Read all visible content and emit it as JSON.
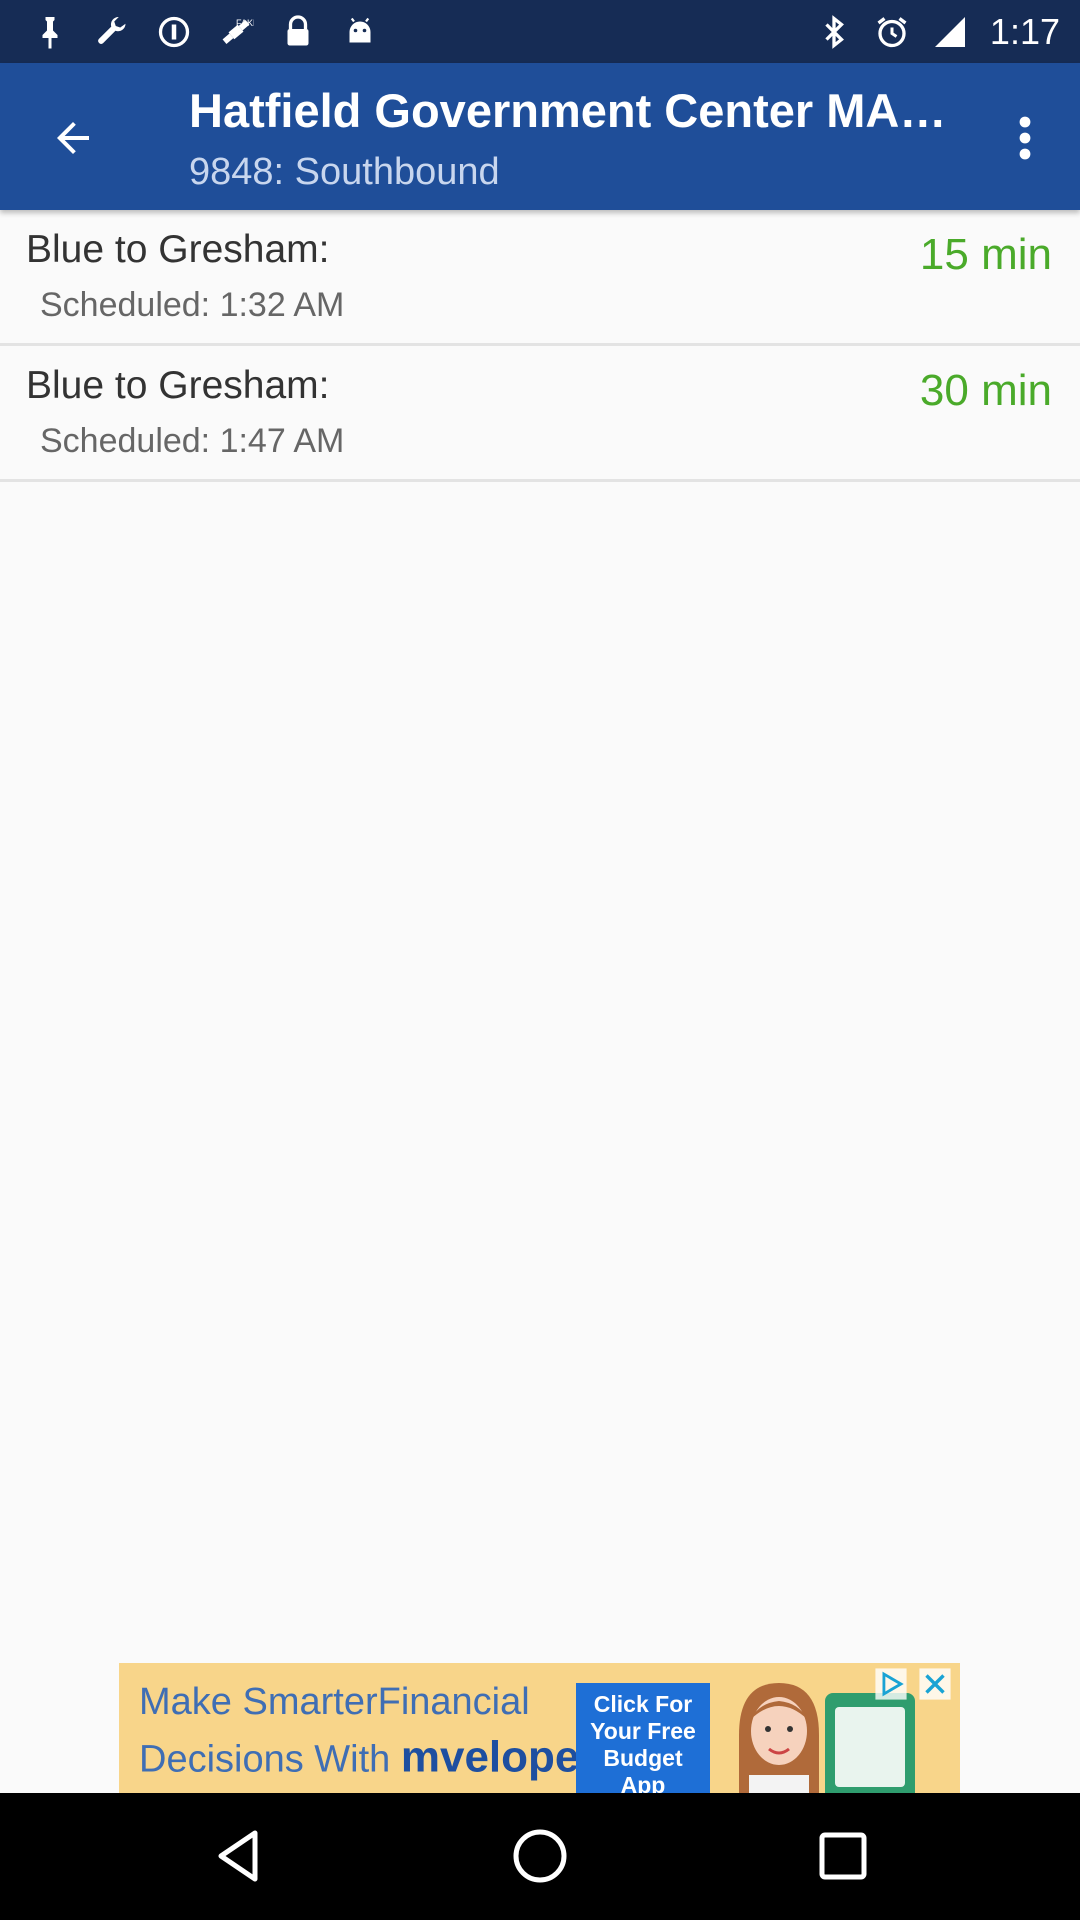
{
  "status_bar": {
    "time": "1:17",
    "left_icons": [
      "pin-icon",
      "wrench-icon",
      "data-saver-icon",
      "fake-gps-icon",
      "lock-icon",
      "android-icon"
    ],
    "right_icons": [
      "bluetooth-icon",
      "alarm-icon",
      "signal-icon"
    ]
  },
  "app_bar": {
    "title": "Hatfield Government Center MAX Station",
    "subtitle": "9848: Southbound",
    "back_icon": "arrow-back-icon",
    "menu_icon": "more-vert-icon"
  },
  "arrivals": [
    {
      "route": "Blue to Gresham:",
      "scheduled": "Scheduled: 1:32 AM",
      "eta": "15 min"
    },
    {
      "route": "Blue to Gresham:",
      "scheduled": "Scheduled: 1:47 AM",
      "eta": "30 min"
    }
  ],
  "ad": {
    "line1": "Make SmarterFinancial",
    "line2_prefix": "Decisions With ",
    "brand": "mvelopes",
    "brand_mark": "®",
    "cta_lines": [
      "Click For",
      "Your Free",
      "Budget",
      "App"
    ]
  },
  "colors": {
    "status_bar": "#162c55",
    "app_bar": "#1f4e99",
    "eta_green": "#4aaa2a",
    "ad_background": "#f8d58a"
  }
}
